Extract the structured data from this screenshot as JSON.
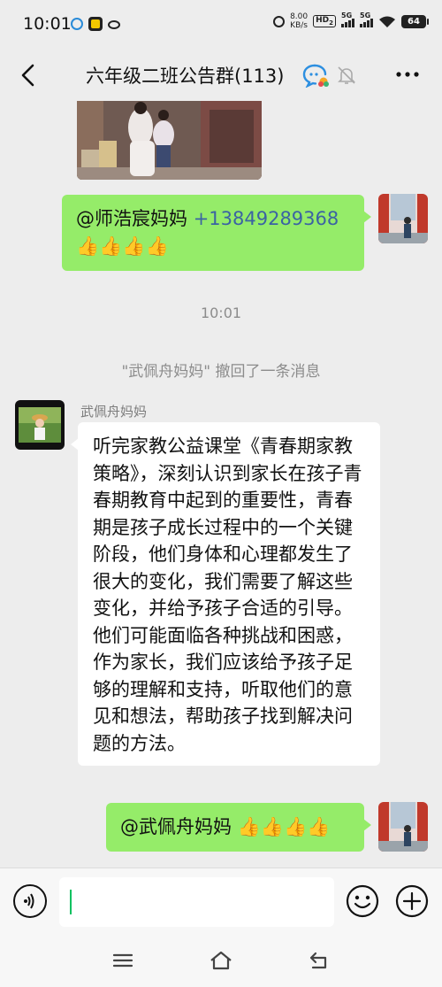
{
  "status_bar": {
    "time": "10:01",
    "net_speed_value": "8.00",
    "net_speed_unit": "KB/s",
    "hd_label": "HD",
    "hd_sub": "2",
    "sig1_label": "5G",
    "sig2_label": "5G",
    "battery": "64"
  },
  "header": {
    "title": "六年级二班公告群(113)",
    "icons": [
      "back-arrow-icon",
      "group-chat-icon",
      "mute-bell-icon",
      "more-icon"
    ]
  },
  "messages": [
    {
      "type": "image",
      "from": "other",
      "description_icon": "photo"
    },
    {
      "type": "text",
      "from": "me",
      "mention": "@师浩宸妈妈",
      "phone": "+13849289368",
      "emoji": "👍👍👍👍"
    },
    {
      "type": "time",
      "text": "10:01"
    },
    {
      "type": "system",
      "text": "\"武佩舟妈妈\" 撤回了一条消息"
    },
    {
      "type": "text",
      "from": "other",
      "sender": "武佩舟妈妈",
      "text": "听完家教公益课堂《青春期家教策略》，深刻认识到家长在孩子青春期教育中起到的重要性，青春期是孩子成长过程中的一个关键阶段，他们身体和心理都发生了很大的变化，我们需要了解这些变化，并给予孩子合适的引导。他们可能面临各种挑战和困惑，作为家长，我们应该给予孩子足够的理解和支持，听取他们的意见和想法，帮助孩子找到解决问题的方法。"
    },
    {
      "type": "text",
      "from": "me",
      "mention": "@武佩舟妈妈",
      "emoji": "👍👍👍👍"
    }
  ],
  "input_bar": {
    "value": "",
    "icons": [
      "voice-icon",
      "emoji-icon",
      "plus-icon"
    ]
  },
  "system_nav": {
    "icons": [
      "menu-icon",
      "home-icon",
      "back-icon"
    ]
  },
  "colors": {
    "background": "#ededed",
    "bubble_out": "#95ec69",
    "bubble_in": "#ffffff",
    "link": "#3b63a3",
    "caret": "#07c160"
  }
}
